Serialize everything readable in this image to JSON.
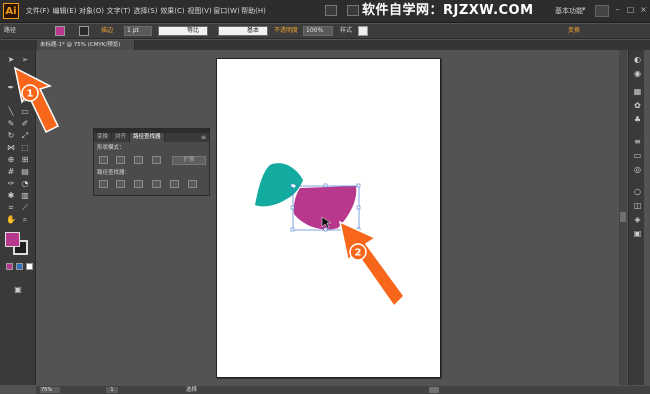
{
  "app": {
    "logo": "Ai",
    "workspace": "基本功能",
    "watermark": "软件自学网：RJZXW.COM"
  },
  "menu": {
    "items": [
      "文件(F)",
      "编辑(E)",
      "对象(O)",
      "文字(T)",
      "选择(S)",
      "效果(C)",
      "视图(V)",
      "窗口(W)",
      "帮助(H)"
    ]
  },
  "control_bar": {
    "selection_label": "路径",
    "stroke_label": "描边",
    "stroke_weight": "1 pt",
    "profile_label": "等比",
    "brush_label": "基本",
    "opacity_label": "不透明度",
    "opacity_value": "100%",
    "style_label": "样式",
    "transform_label": "变换",
    "fill_color": "#b8388e"
  },
  "document": {
    "tab_label": "未标题-1* @ 75% (CMYK/预览)"
  },
  "panel": {
    "tabs": [
      "变换",
      "对齐",
      "路径查找器"
    ],
    "active_tab": "路径查找器",
    "shape_modes_label": "形状模式：",
    "pathfinder_label": "路径查找器：",
    "expand_label": "扩展"
  },
  "status": {
    "zoom": "75%",
    "page": "1",
    "tool": "选择"
  },
  "annotations": {
    "marker1": "1",
    "marker2": "2"
  },
  "colors": {
    "accent": "#f7661a",
    "teal_shape": "#13aaa0",
    "magenta_shape": "#b8388e",
    "selection": "#4a7bd4"
  }
}
